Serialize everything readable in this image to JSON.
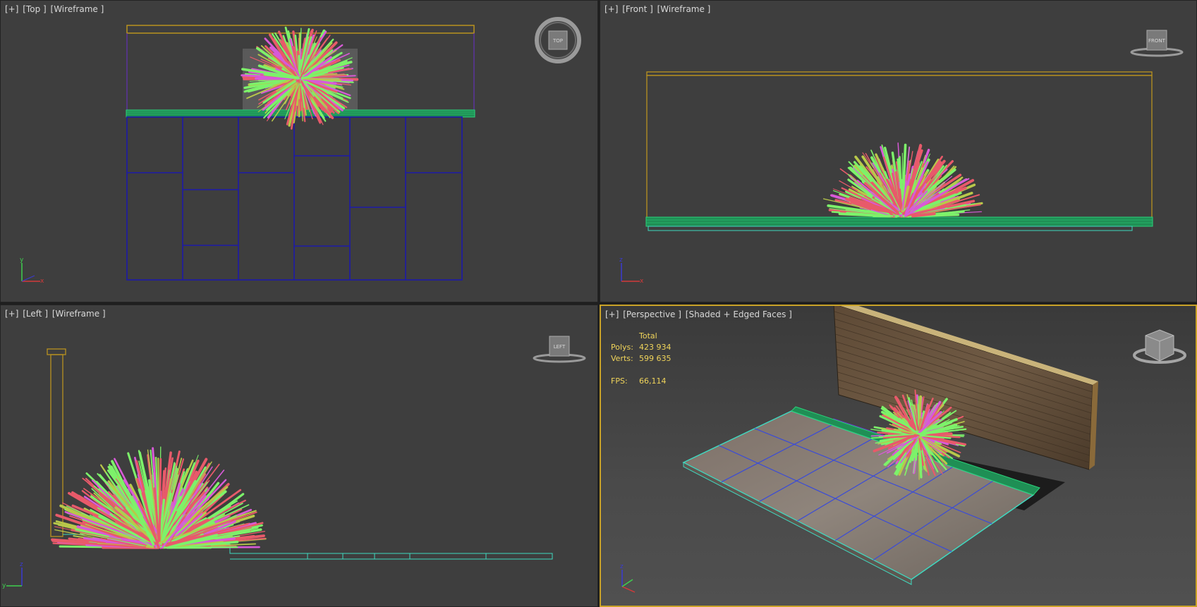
{
  "viewports": {
    "top": {
      "plus": "[+]",
      "view": "[Top ]",
      "mode": "[Wireframe ]",
      "cube": "TOP"
    },
    "front": {
      "plus": "[+]",
      "view": "[Front ]",
      "mode": "[Wireframe ]",
      "cube": "FRONT"
    },
    "left": {
      "plus": "[+]",
      "view": "[Left ]",
      "mode": "[Wireframe ]",
      "cube": "LEFT"
    },
    "perspective": {
      "plus": "[+]",
      "view": "[Perspective ]",
      "mode": "[Shaded + Edged Faces ]"
    }
  },
  "stats": {
    "header": "Total",
    "polys_label": "Polys:",
    "polys": "423 934",
    "verts_label": "Verts:",
    "verts": "599 635",
    "fps_label": "FPS:",
    "fps": "66,114"
  },
  "colors": {
    "viewport_bg": "#3e3e3e",
    "wall": "#b8921f",
    "tiles": "#1d1aa8",
    "hedge": "#2bd17a",
    "plant_green": "#7df26a",
    "plant_red": "#e85a6a",
    "active_border": "#c9a227",
    "stats_text": "#f0d45a"
  },
  "icons": {
    "viewcube": "viewcube-icon",
    "steering_wheel": "steering-wheel-icon",
    "axis_tripod": "axis-tripod-icon"
  }
}
